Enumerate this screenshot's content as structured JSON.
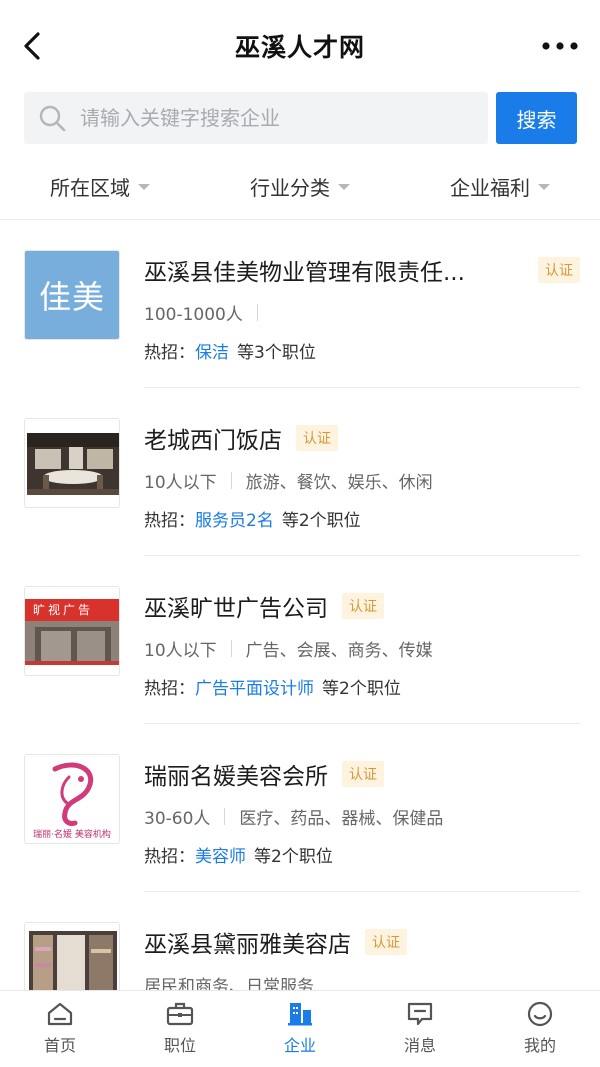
{
  "header": {
    "title": "巫溪人才网"
  },
  "search": {
    "placeholder": "请输入关键字搜索企业",
    "button_label": "搜索"
  },
  "filters": [
    {
      "label": "所在区域"
    },
    {
      "label": "行业分类"
    },
    {
      "label": "企业福利"
    }
  ],
  "colors": {
    "accent": "#1a7ce8",
    "badge_bg": "#fdf3df",
    "badge_text": "#d59a3b"
  },
  "companies": [
    {
      "logo_text": "佳美",
      "name": "巫溪县佳美物业管理有限责任...",
      "badge": "认证",
      "size": "100-1000人",
      "industry": "",
      "hot_prefix": "热招：",
      "hot_job": "保洁",
      "hot_suffix": "等3个职位"
    },
    {
      "name": "老城西门饭店",
      "badge": "认证",
      "size": "10人以下",
      "industry": "旅游、餐饮、娱乐、休闲",
      "hot_prefix": "热招：",
      "hot_job": "服务员2名",
      "hot_suffix": "等2个职位"
    },
    {
      "logo_text": "旷视广告",
      "name": "巫溪旷世广告公司",
      "badge": "认证",
      "size": "10人以下",
      "industry": "广告、会展、商务、传媒",
      "hot_prefix": "热招：",
      "hot_job": "广告平面设计师",
      "hot_suffix": "等2个职位"
    },
    {
      "logo_text": "瑞丽·名媛 美容机构",
      "name": "瑞丽名媛美容会所",
      "badge": "认证",
      "size": "30-60人",
      "industry": "医疗、药品、器械、保健品",
      "hot_prefix": "热招：",
      "hot_job": "美容师",
      "hot_suffix": "等2个职位"
    },
    {
      "name": "巫溪县黛丽雅美容店",
      "badge": "认证",
      "size": "居民和商务、日常服务",
      "industry": "",
      "hot_prefix": "",
      "hot_job": "",
      "hot_suffix": ""
    }
  ],
  "tabbar": [
    {
      "label": "首页",
      "icon": "home-icon"
    },
    {
      "label": "职位",
      "icon": "briefcase-icon"
    },
    {
      "label": "企业",
      "icon": "building-icon",
      "active": true
    },
    {
      "label": "消息",
      "icon": "message-icon"
    },
    {
      "label": "我的",
      "icon": "profile-icon"
    }
  ]
}
